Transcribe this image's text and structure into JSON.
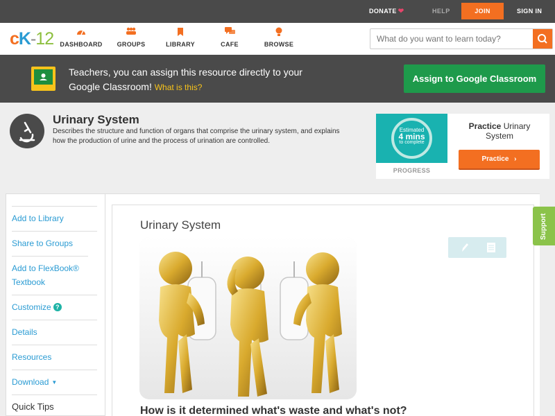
{
  "topbar": {
    "donate": "DONATE",
    "help": "HELP",
    "join": "JOIN",
    "signin": "SIGN IN"
  },
  "logo": {
    "c": "c",
    "k": "K",
    "dash": "-",
    "num": "12"
  },
  "nav": [
    {
      "label": "DASHBOARD",
      "icon": "dashboard-icon"
    },
    {
      "label": "GROUPS",
      "icon": "groups-icon"
    },
    {
      "label": "LIBRARY",
      "icon": "library-icon"
    },
    {
      "label": "CAFE",
      "icon": "cafe-icon"
    },
    {
      "label": "BROWSE",
      "icon": "browse-icon"
    }
  ],
  "search": {
    "placeholder": "What do you want to learn today?"
  },
  "banner": {
    "message": "Teachers, you can assign this resource directly to your Google Classroom!",
    "what": "What is this?",
    "assign": "Assign to Google Classroom"
  },
  "concept": {
    "title": "Urinary System",
    "description": "Describes the structure and function of organs that comprise the urinary system, and explains how the production of urine and the process of urination are controlled."
  },
  "practice": {
    "estimate_l1": "Estimated",
    "estimate_l2": "4 mins",
    "estimate_l3": "to complete",
    "progress_label": "PROGRESS",
    "title_bold": "Practice",
    "title_rest": "Urinary System",
    "button": "Practice"
  },
  "sidebar": {
    "items": [
      "Add to Library",
      "Share to Groups",
      "Add to FlexBook® Textbook",
      "Customize",
      "Details",
      "Resources",
      "Download"
    ],
    "tips": "Quick Tips"
  },
  "content": {
    "title": "Urinary System",
    "subheading": "How is it determined what's waste and what's not?"
  },
  "support": "Support",
  "colors": {
    "accent": "#f36f21",
    "link": "#2a9bd3",
    "google_green": "#1e9a4b",
    "dark_bar": "#4a4a4a"
  }
}
